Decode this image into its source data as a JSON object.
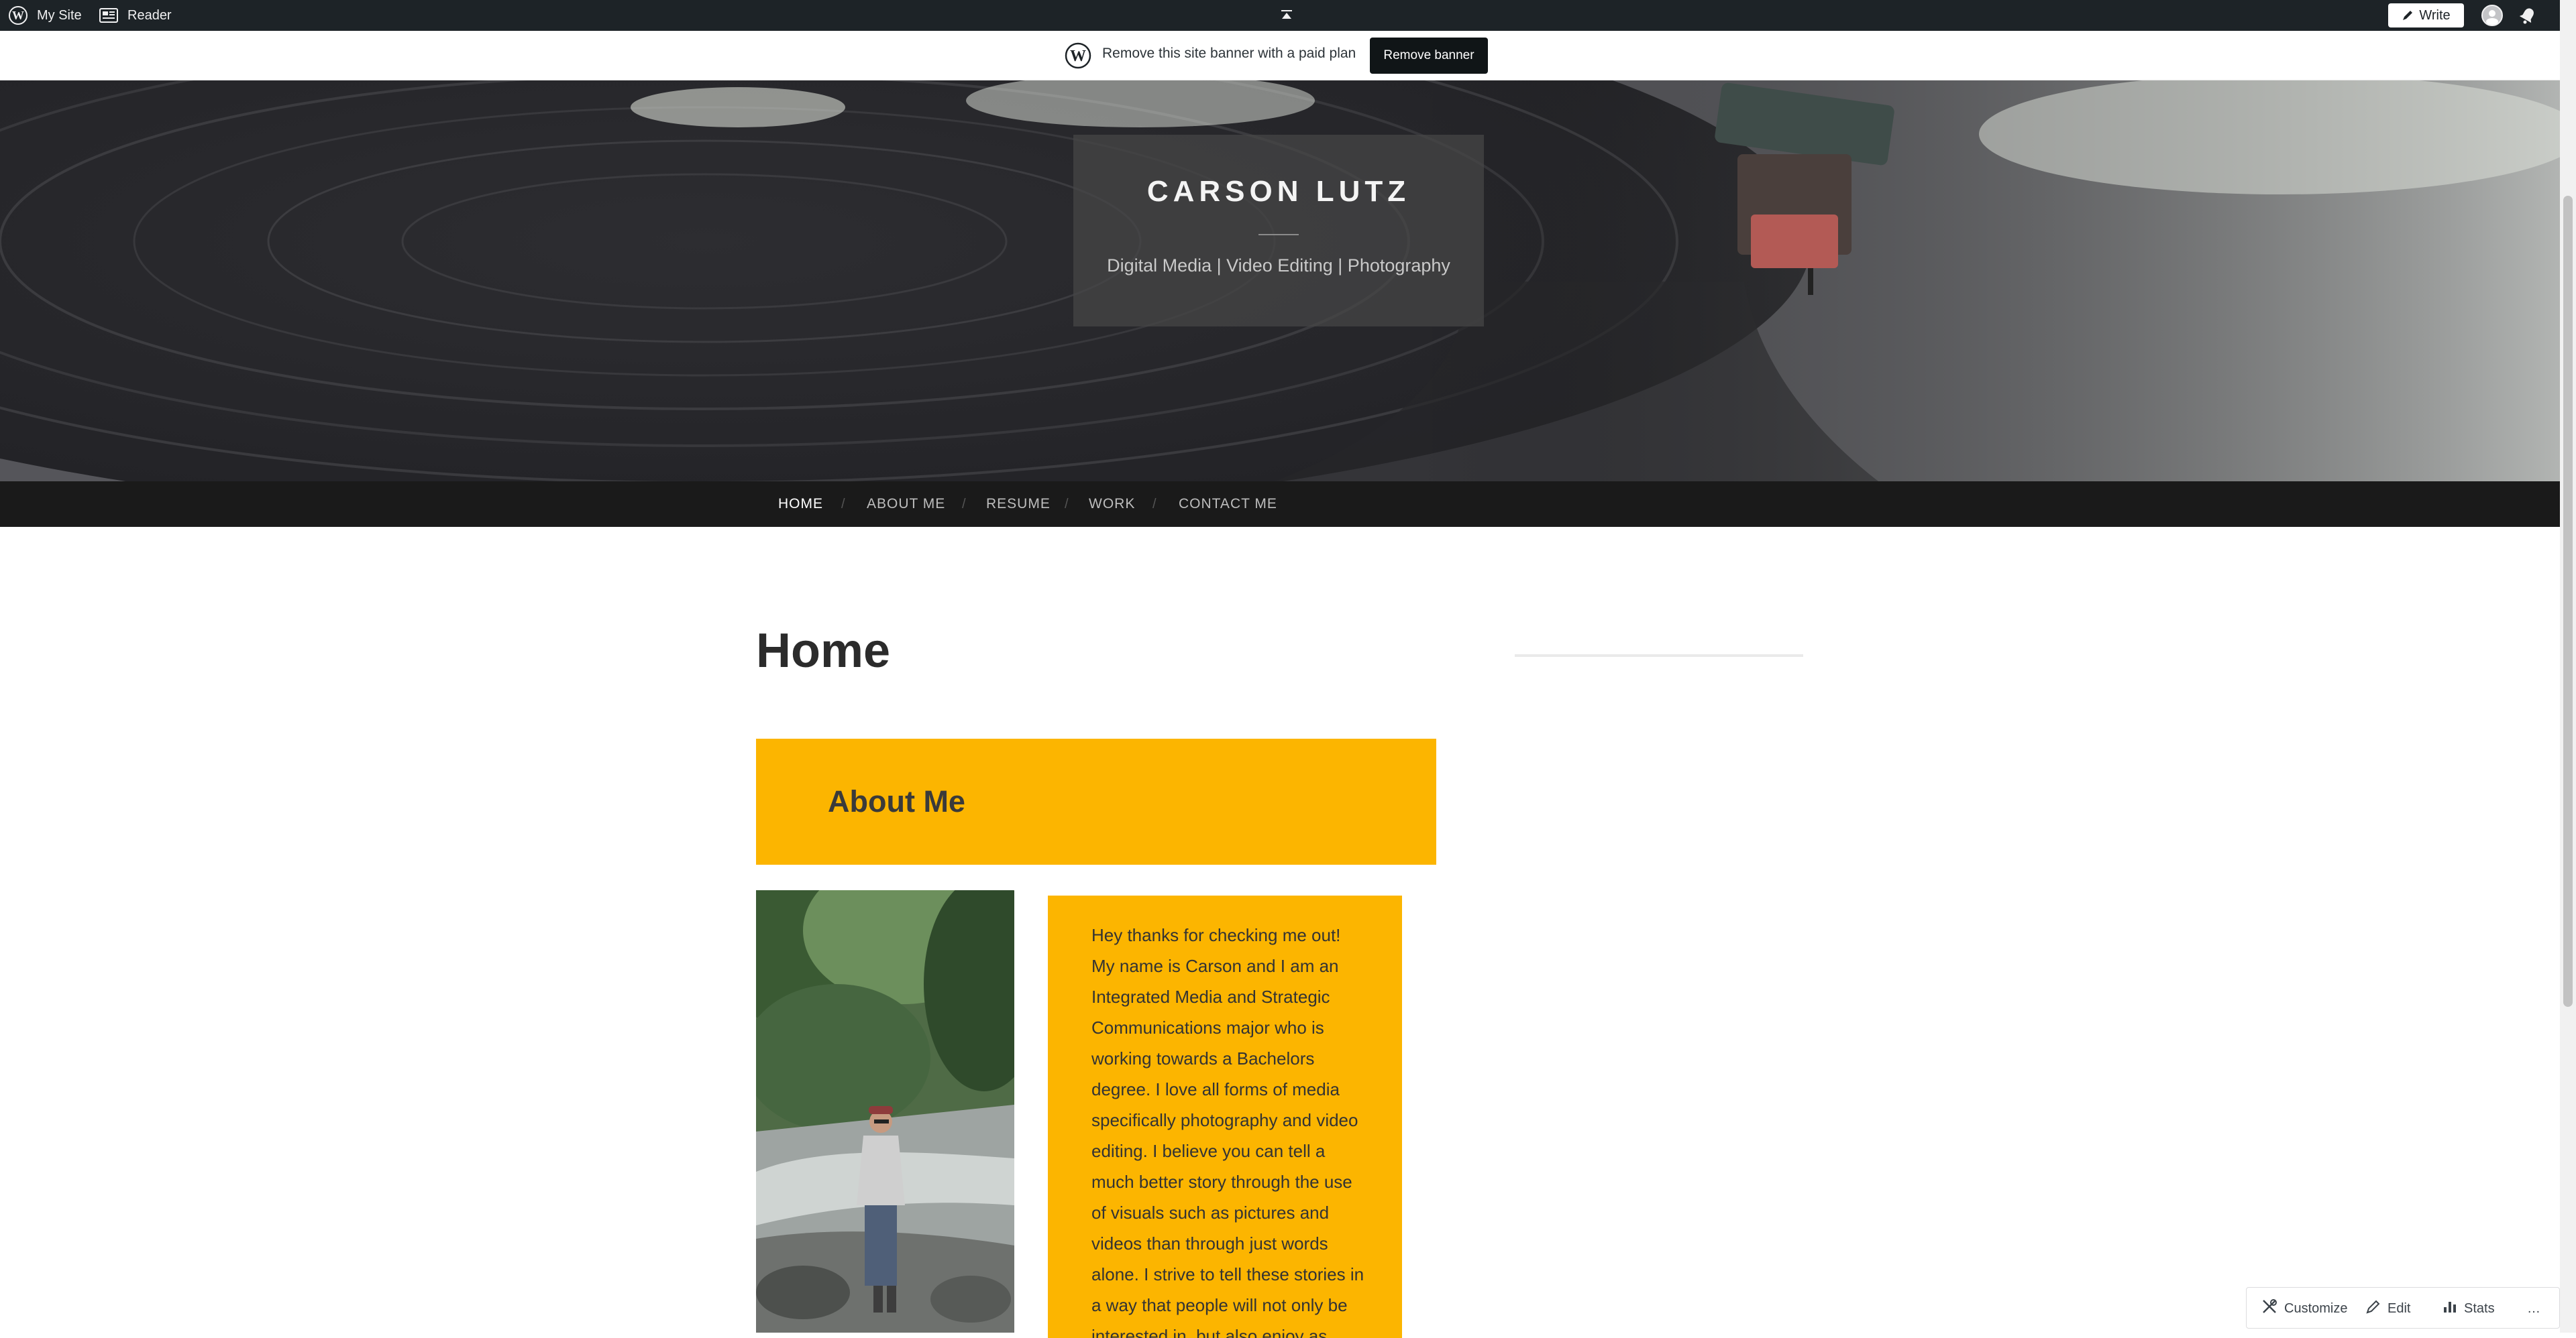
{
  "admin_bar": {
    "my_site_label": "My Site",
    "reader_label": "Reader",
    "write_label": "Write",
    "bg_color": "#1d2327"
  },
  "site_banner": {
    "message": "Remove this site banner with a paid plan",
    "button_label": "Remove banner"
  },
  "site": {
    "title": "CARSON LUTZ",
    "description": "Digital Media | Video Editing | Photography"
  },
  "nav": {
    "items": [
      {
        "label": "HOME",
        "active": true
      },
      {
        "label": "ABOUT ME"
      },
      {
        "label": "RESUME"
      },
      {
        "label": "WORK"
      },
      {
        "label": "CONTACT ME"
      }
    ],
    "separator": "/"
  },
  "main": {
    "page_title": "Home",
    "about_heading": "About Me",
    "bio": "Hey thanks for checking me out! My name is Carson and I am an Integrated Media and Strategic Communications major who is working towards a Bachelors degree. I love all forms of media specifically photography and video editing. I believe you can tell a much better story through the use of visuals such as pictures and videos than through just words alone. I strive to tell these stories in a way that people will not only be interested in, but also enjoy as"
  },
  "admin_actions": {
    "customize_label": "Customize",
    "edit_label": "Edit",
    "stats_label": "Stats",
    "more_label": "…"
  },
  "colors": {
    "accent_yellow": "#fcb500",
    "nav_bg": "#1a1a1a",
    "banner_button": "#101517"
  },
  "icons": {
    "wordpress": "wordpress-logo-icon",
    "reader": "reader-icon",
    "collapse": "collapse-up-icon",
    "write": "pencil-icon",
    "avatar": "user-avatar-icon",
    "notifications": "bell-icon",
    "customize": "customize-tools-icon",
    "edit": "pencil-icon",
    "stats": "bar-chart-icon"
  }
}
